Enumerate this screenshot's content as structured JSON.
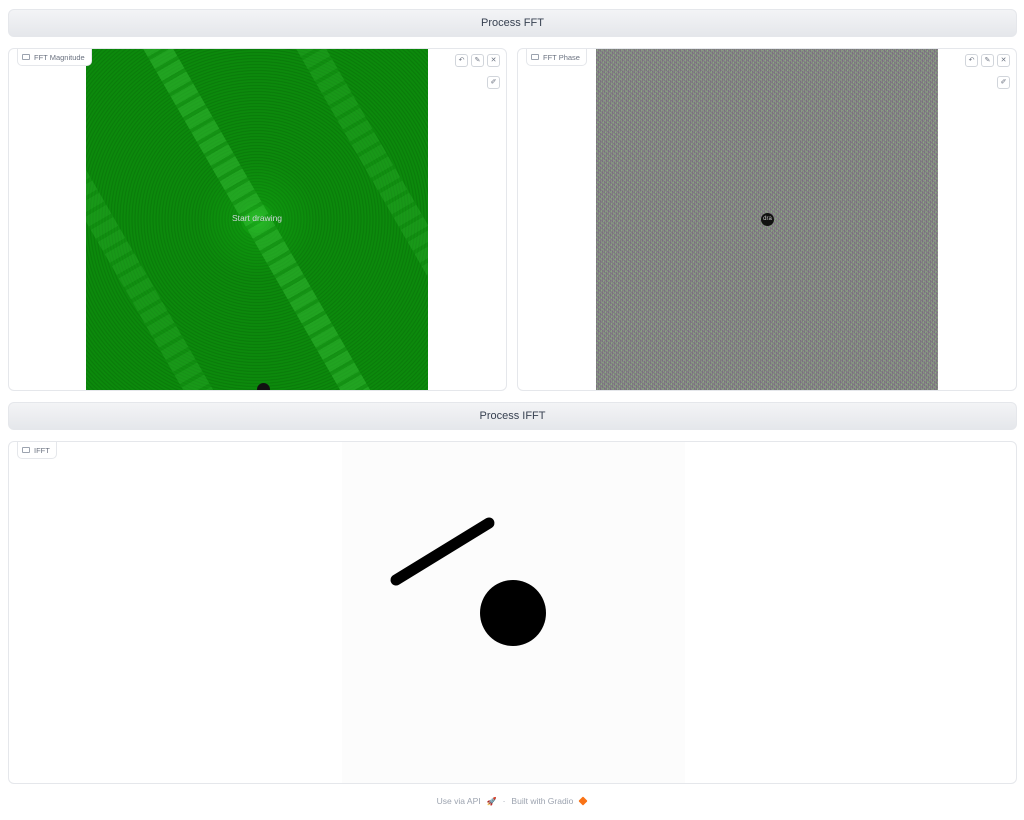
{
  "buttons": {
    "process_fft": "Process FFT",
    "process_ifft": "Process IFFT"
  },
  "panels": {
    "magnitude": {
      "label": "FFT Magnitude",
      "hint": "Start drawing",
      "label_icon": "image-icon"
    },
    "phase": {
      "label": "FFT Phase",
      "hint": "dra",
      "label_icon": "image-icon"
    },
    "ifft": {
      "label": "IFFT",
      "label_icon": "image-icon"
    }
  },
  "toolbar": {
    "undo_icon": "undo-icon",
    "edit_icon": "pencil-icon",
    "clear_icon": "close-icon",
    "brush_icon": "brush-icon"
  },
  "footer": {
    "api_link": "Use via API",
    "separator": "·",
    "built_with": "Built with Gradio"
  },
  "colors": {
    "magnitude_green": "#0a800a",
    "phase_gray": "#8a8f86",
    "accent_orange": "#f97316"
  }
}
